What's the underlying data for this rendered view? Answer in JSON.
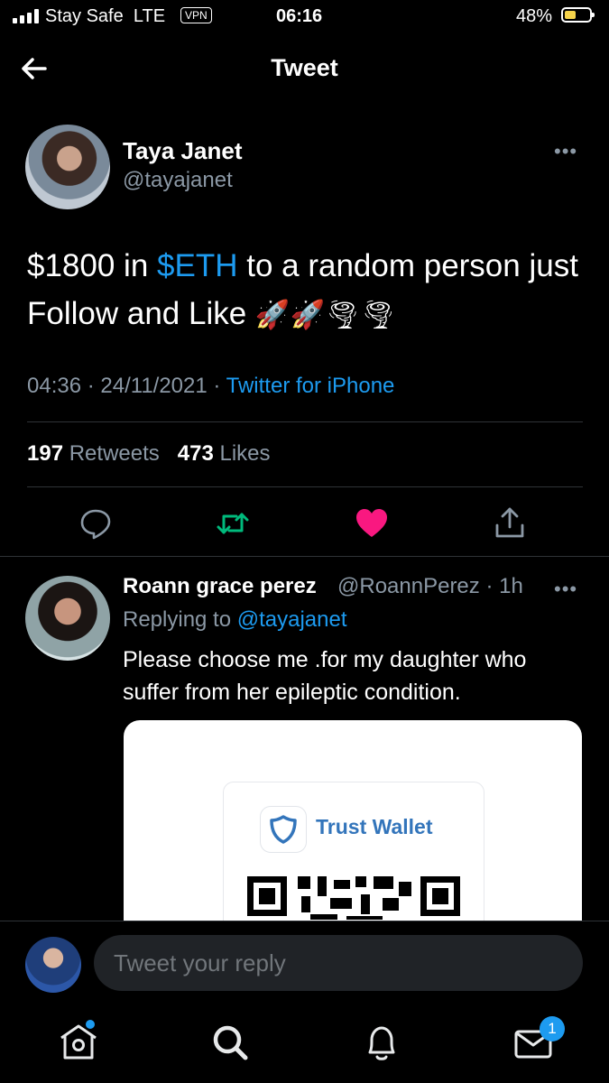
{
  "status_bar": {
    "carrier": "Stay Safe",
    "network": "LTE",
    "vpn": "VPN",
    "time": "06:16",
    "battery": "48%",
    "battery_level": 0.48
  },
  "header": {
    "title": "Tweet",
    "back_icon": "arrow-left-icon"
  },
  "tweet": {
    "author_name": "Taya Janet",
    "author_handle": "@tayajanet",
    "text_part1": "$1800 in ",
    "cashtag": "$ETH",
    "text_part2": " to a random person just Follow and Like ",
    "emojis": "🚀🚀🌪🌪",
    "time": "04:36",
    "date": "24/11/2021",
    "source": "Twitter for iPhone",
    "retweets_count": "197",
    "retweets_label": "Retweets",
    "likes_count": "473",
    "likes_label": "Likes",
    "liked": true
  },
  "reply": {
    "name": "Roann grace perez",
    "handle": "@RoannPerez",
    "age": "1h",
    "replying_to_label": "Replying to",
    "replying_to": "@tayajanet",
    "text": "Please choose me .for my daughter who suffer from her epileptic condition.",
    "media_label": "Trust Wallet"
  },
  "compose": {
    "placeholder": "Tweet your reply"
  },
  "tab_bar": {
    "notification_badge": "1",
    "icons": [
      "home-icon",
      "search-icon",
      "bell-icon",
      "mail-icon"
    ]
  },
  "colors": {
    "accent": "#1d9bf0",
    "like": "#f91880",
    "retweet": "#00ba7c",
    "muted": "#8b98a5"
  }
}
